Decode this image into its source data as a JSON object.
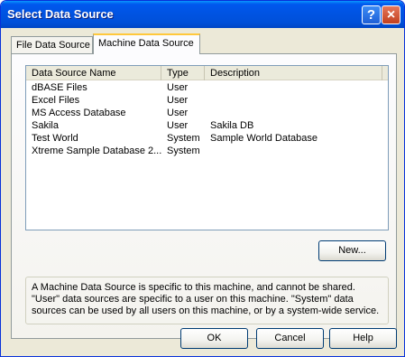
{
  "window": {
    "title": "Select Data Source",
    "help_glyph": "?",
    "close_glyph": "×"
  },
  "tabs": [
    {
      "label": "File Data Source",
      "selected": false
    },
    {
      "label": "Machine Data Source",
      "selected": true
    }
  ],
  "list": {
    "columns": [
      "Data Source Name",
      "Type",
      "Description"
    ],
    "rows": [
      {
        "name": "dBASE Files",
        "type": "User",
        "description": ""
      },
      {
        "name": "Excel Files",
        "type": "User",
        "description": ""
      },
      {
        "name": "MS Access Database",
        "type": "User",
        "description": ""
      },
      {
        "name": "Sakila",
        "type": "User",
        "description": "Sakila DB"
      },
      {
        "name": "Test World",
        "type": "System",
        "description": "Sample World Database"
      },
      {
        "name": "Xtreme Sample Database 2...",
        "type": "System",
        "description": ""
      }
    ]
  },
  "new_button": "New...",
  "info": {
    "lines": [
      "A Machine Data Source is specific to this machine, and cannot be shared.",
      "\"User\" data sources are specific to a user on this machine.  \"System\" data",
      "sources can be used by all users on this machine, or by a system-wide service."
    ]
  },
  "buttons": {
    "ok": "OK",
    "cancel": "Cancel",
    "help": "Help"
  },
  "colors": {
    "titlebar": "#0053e1",
    "dialog_bg": "#ece9d8",
    "tab_highlight": "#ffc83c"
  }
}
